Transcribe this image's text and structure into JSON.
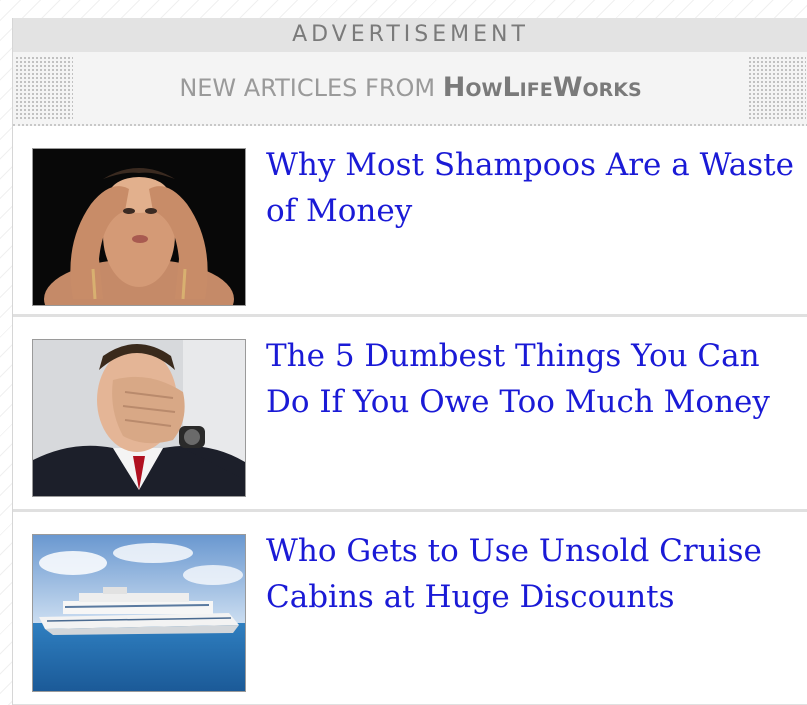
{
  "ad_label": "ADVERTISEMENT",
  "header": {
    "prefix": "NEW ARTICLES FROM",
    "brand": "HowLifeWorks"
  },
  "articles": [
    {
      "title": "Why Most Shampoos Are a Waste of Money",
      "thumbnail": "woman-washing-hair-image"
    },
    {
      "title": "The 5 Dumbest Things You Can Do If You Owe Too Much Money",
      "thumbnail": "man-covering-face-image"
    },
    {
      "title": "Who Gets to Use Unsold Cruise Cabins at Huge Discounts",
      "thumbnail": "cruise-ship-image"
    }
  ],
  "colors": {
    "link": "#1a1ad6",
    "label_bg": "#e3e3e3",
    "header_text": "#9a9a9a"
  }
}
